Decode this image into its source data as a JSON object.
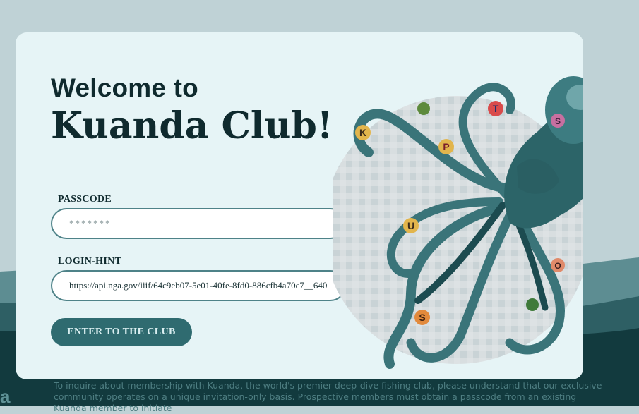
{
  "welcome": {
    "line1": "Welcome to",
    "line2": "Kuanda Club!"
  },
  "form": {
    "passcode_label": "PASSCODE",
    "passcode_placeholder": "*******",
    "login_hint_label": "LOGIN-HINT",
    "login_hint_value": "https://api.nga.gov/iiif/64c9eb07-5e01-40fe-8fd0-886cfb4a70c7__640",
    "submit_label": "ENTER TO THE CLUB"
  },
  "footer": {
    "text": "To inquire about membership with Kuanda, the world's premier deep-dive fishing club, please understand that our exclusive community operates on a unique invitation-only basis. Prospective members must obtain a passcode from an existing Kuanda member to initiate"
  },
  "art": {
    "description_icon": "octopus-illustration-icon",
    "letters": [
      "K",
      "P",
      "T",
      "S",
      "U",
      "O",
      "S"
    ]
  },
  "colors": {
    "page_bg": "#bfd2d6",
    "card_bg": "#e6f4f6",
    "accent": "#2f6b70",
    "field_border": "#4e8288",
    "dark_wave": "#0f3336",
    "text_dark": "#0f2a2e"
  }
}
